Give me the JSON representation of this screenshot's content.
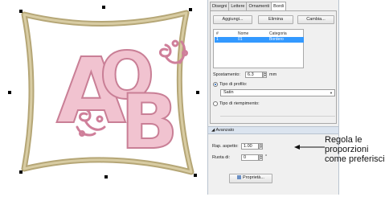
{
  "panel": {
    "tabs": [
      {
        "label": "Disegni"
      },
      {
        "label": "Lettere"
      },
      {
        "label": "Ornamenti"
      },
      {
        "label": "Bordi"
      }
    ],
    "active_tab": "Bordi",
    "buttons": {
      "add": "Aggiungi...",
      "delete": "Elimina",
      "change": "Cambia..."
    },
    "list": {
      "headers": {
        "num": "#",
        "name": "Nome",
        "category": "Categoria"
      },
      "rows": [
        {
          "num": "1",
          "name": "01",
          "category": "Bordero"
        }
      ]
    },
    "offset": {
      "label": "Spostamento:",
      "value": "6.3",
      "unit": "mm"
    },
    "outline": {
      "label": "Tipo di profilo:",
      "value": "Satin",
      "selected": true
    },
    "fill": {
      "label": "Tipo di riempimento:",
      "selected": false
    },
    "advanced": {
      "title": "Avanzato",
      "aspect": {
        "label": "Rap. aspetto:",
        "value": "1.00"
      },
      "rotate": {
        "label": "Ruota di:",
        "value": "0",
        "unit": "°"
      },
      "properties_button": "Proprietà..."
    }
  },
  "artwork": {
    "letters": [
      "A",
      "O",
      "B"
    ],
    "border_color": "#c8b98c",
    "letter_color": "#e5a6b8"
  },
  "callout": {
    "text": "Regola le proporzioni come preferisci"
  }
}
